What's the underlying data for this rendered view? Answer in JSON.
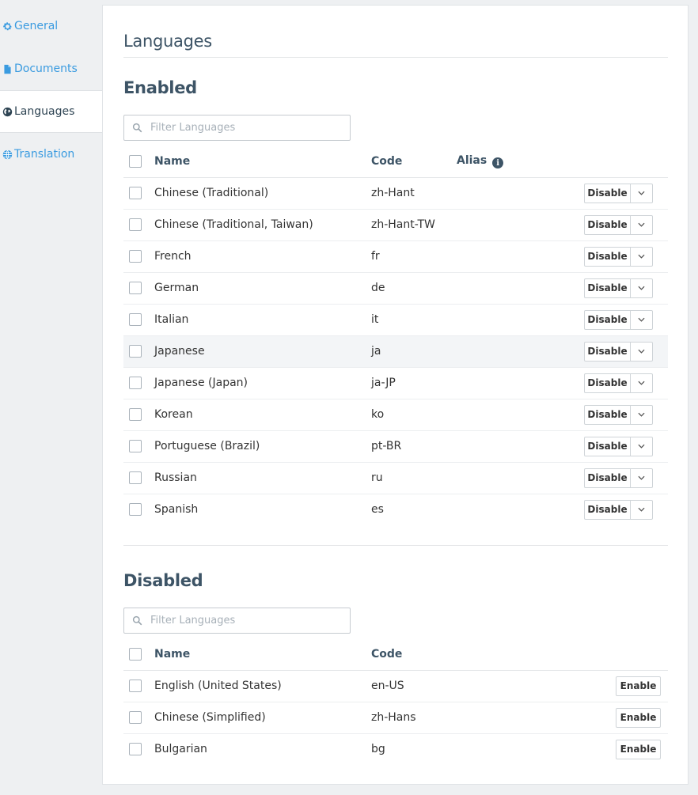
{
  "sidebar": {
    "items": [
      {
        "label": "General",
        "icon": "gear-icon"
      },
      {
        "label": "Documents",
        "icon": "document-icon"
      },
      {
        "label": "Languages",
        "icon": "globe-icon",
        "active": true
      },
      {
        "label": "Translation",
        "icon": "translation-globe-icon"
      }
    ]
  },
  "page": {
    "title": "Languages"
  },
  "enabled": {
    "title": "Enabled",
    "filter_placeholder": "Filter Languages",
    "columns": {
      "name": "Name",
      "code": "Code",
      "alias": "Alias"
    },
    "action_label": "Disable",
    "rows": [
      {
        "name": "Chinese (Traditional)",
        "code": "zh-Hant"
      },
      {
        "name": "Chinese (Traditional, Taiwan)",
        "code": "zh-Hant-TW"
      },
      {
        "name": "French",
        "code": "fr"
      },
      {
        "name": "German",
        "code": "de"
      },
      {
        "name": "Italian",
        "code": "it"
      },
      {
        "name": "Japanese",
        "code": "ja"
      },
      {
        "name": "Japanese (Japan)",
        "code": "ja-JP"
      },
      {
        "name": "Korean",
        "code": "ko"
      },
      {
        "name": "Portuguese (Brazil)",
        "code": "pt-BR"
      },
      {
        "name": "Russian",
        "code": "ru"
      },
      {
        "name": "Spanish",
        "code": "es"
      }
    ]
  },
  "disabled": {
    "title": "Disabled",
    "filter_placeholder": "Filter Languages",
    "columns": {
      "name": "Name",
      "code": "Code"
    },
    "action_label": "Enable",
    "rows": [
      {
        "name": "English (United States)",
        "code": "en-US"
      },
      {
        "name": "Chinese (Simplified)",
        "code": "zh-Hans"
      },
      {
        "name": "Bulgarian",
        "code": "bg"
      }
    ]
  },
  "colors": {
    "accent": "#3a9be0",
    "heading": "#3d5466",
    "code_text": "#8aa0b3"
  }
}
